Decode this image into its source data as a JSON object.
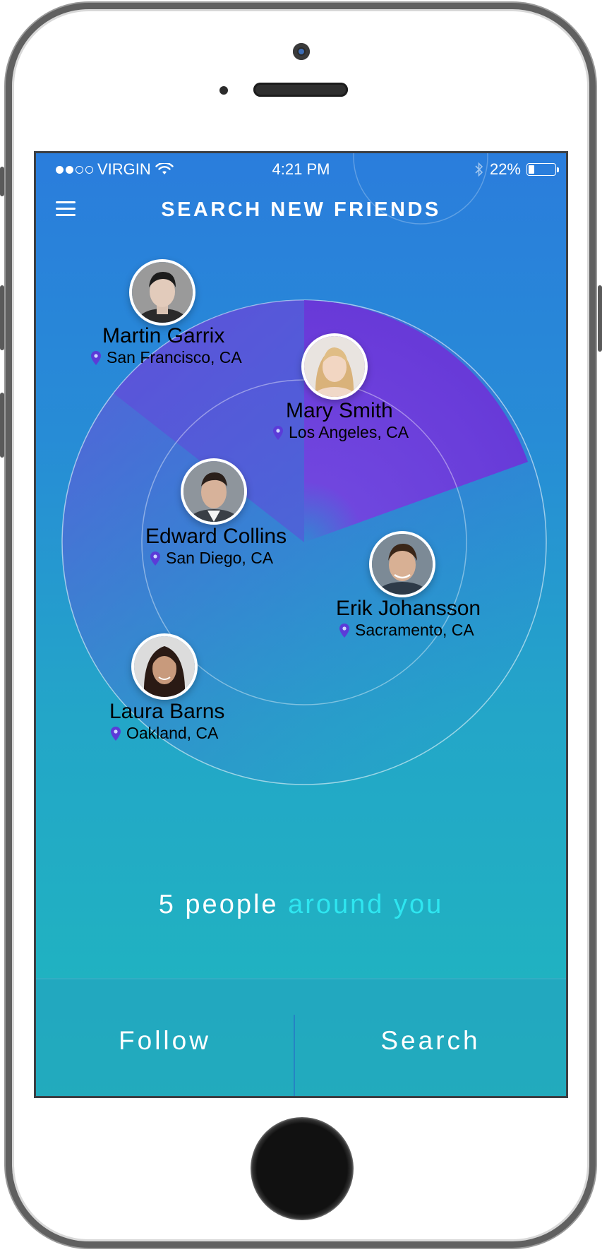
{
  "status_bar": {
    "carrier": "VIRGIN",
    "signal_dots": [
      true,
      true,
      false,
      false
    ],
    "time": "4:21 PM",
    "battery_percent": "22%",
    "battery_level": 0.22,
    "icons": [
      "wifi-icon",
      "bluetooth-icon",
      "battery-icon"
    ]
  },
  "header": {
    "title": "SEARCH NEW FRIENDS",
    "menu_icon": "menu-icon"
  },
  "people": [
    {
      "name": "Martin Garrix",
      "location": "San Francisco, CA"
    },
    {
      "name": "Mary Smith",
      "location": "Los Angeles, CA"
    },
    {
      "name": "Edward Collins",
      "location": "San Diego, CA"
    },
    {
      "name": "Erik Johansson",
      "location": "Sacramento, CA"
    },
    {
      "name": "Laura Barns",
      "location": "Oakland, CA"
    }
  ],
  "summary": {
    "count": "5",
    "people_word": "people",
    "highlight": "around you"
  },
  "actions": {
    "follow_label": "Follow",
    "search_label": "Search"
  },
  "colors": {
    "accent": "#2ee6f0",
    "radar_sweep": "#7a3ce0",
    "pin": "#5b3bd8"
  }
}
